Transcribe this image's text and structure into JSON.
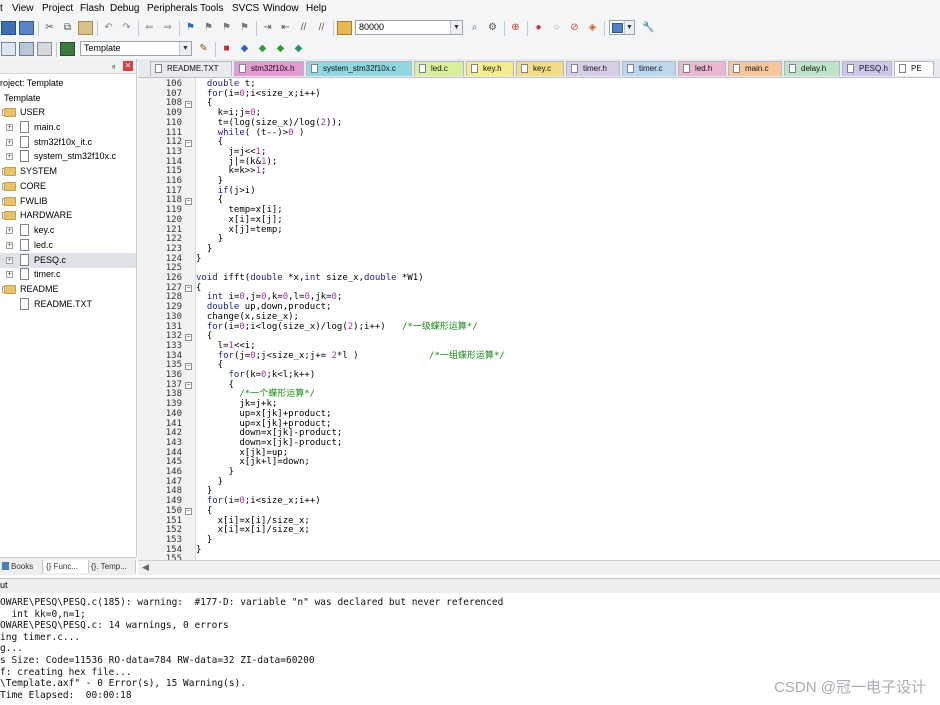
{
  "menu": [
    "t",
    "View",
    "Project",
    "Flash",
    "Debug",
    "Peripherals",
    "Tools",
    "SVCS",
    "Window",
    "Help"
  ],
  "toolbar1": {
    "target_value": "80000"
  },
  "toolbar2": {
    "target_name": "Template"
  },
  "project": {
    "title": "roject: Template",
    "root": "Template",
    "tree": [
      {
        "label": "USER",
        "kind": "folder",
        "level": 1,
        "expander": "−"
      },
      {
        "label": "main.c",
        "kind": "file",
        "level": 2,
        "expander": "+"
      },
      {
        "label": "stm32f10x_it.c",
        "kind": "file",
        "level": 2,
        "expander": "+"
      },
      {
        "label": "system_stm32f10x.c",
        "kind": "file",
        "level": 2,
        "expander": "+"
      },
      {
        "label": "SYSTEM",
        "kind": "folder",
        "level": 1,
        "expander": "+"
      },
      {
        "label": "CORE",
        "kind": "folder",
        "level": 1,
        "expander": "+"
      },
      {
        "label": "FWLIB",
        "kind": "folder",
        "level": 1,
        "expander": "+"
      },
      {
        "label": "HARDWARE",
        "kind": "folder",
        "level": 1,
        "expander": "−"
      },
      {
        "label": "key.c",
        "kind": "file",
        "level": 2,
        "expander": "+"
      },
      {
        "label": "led.c",
        "kind": "file",
        "level": 2,
        "expander": "+"
      },
      {
        "label": "PESQ.c",
        "kind": "file",
        "level": 2,
        "expander": "+",
        "selected": true
      },
      {
        "label": "timer.c",
        "kind": "file",
        "level": 2,
        "expander": "+"
      },
      {
        "label": "README",
        "kind": "folder",
        "level": 1,
        "expander": "−"
      },
      {
        "label": "README.TXT",
        "kind": "file",
        "level": 2,
        "expander": ""
      }
    ],
    "bottom_tabs": [
      "Books",
      "{} Func...",
      "{}. Temp..."
    ]
  },
  "editor": {
    "tabs": [
      {
        "label": "README.TXT",
        "color": "#e8eaed"
      },
      {
        "label": "stm32f10x.h",
        "color": "#e59ad0"
      },
      {
        "label": "system_stm32f10x.c",
        "color": "#8fd8e0"
      },
      {
        "label": "led.c",
        "color": "#d8ef9c"
      },
      {
        "label": "key.h",
        "color": "#f3ed8a"
      },
      {
        "label": "key.c",
        "color": "#f2dc86"
      },
      {
        "label": "timer.h",
        "color": "#d6cde6"
      },
      {
        "label": "timer.c",
        "color": "#bcd6ee"
      },
      {
        "label": "led.h",
        "color": "#e9b7cf"
      },
      {
        "label": "main.c",
        "color": "#f6c79b"
      },
      {
        "label": "delay.h",
        "color": "#bfe3c8"
      },
      {
        "label": "PESQ.h",
        "color": "#ccc6ea"
      },
      {
        "label": "PE",
        "color": "#ffffff"
      }
    ],
    "active_tab": "PESQ.c",
    "lines": [
      {
        "n": "106",
        "f": "",
        "t": "  double t;"
      },
      {
        "n": "107",
        "f": "",
        "t": "  for(i=0;i<size_x;i++)"
      },
      {
        "n": "108",
        "f": "−",
        "t": "  {"
      },
      {
        "n": "109",
        "f": "",
        "t": "    k=i;j=0;"
      },
      {
        "n": "110",
        "f": "",
        "t": "    t=(log(size_x)/log(2));"
      },
      {
        "n": "111",
        "f": "",
        "t": "    while( (t--)>0 )"
      },
      {
        "n": "112",
        "f": "−",
        "t": "    {"
      },
      {
        "n": "113",
        "f": "",
        "t": "      j=j<<1;"
      },
      {
        "n": "114",
        "f": "",
        "t": "      j|=(k&1);"
      },
      {
        "n": "115",
        "f": "",
        "t": "      k=k>>1;"
      },
      {
        "n": "116",
        "f": "",
        "t": "    }"
      },
      {
        "n": "117",
        "f": "",
        "t": "    if(j>i)"
      },
      {
        "n": "118",
        "f": "−",
        "t": "    {"
      },
      {
        "n": "119",
        "f": "",
        "t": "      temp=x[i];"
      },
      {
        "n": "120",
        "f": "",
        "t": "      x[i]=x[j];"
      },
      {
        "n": "121",
        "f": "",
        "t": "      x[j]=temp;"
      },
      {
        "n": "122",
        "f": "",
        "t": "    }"
      },
      {
        "n": "123",
        "f": "",
        "t": "  }"
      },
      {
        "n": "124",
        "f": "",
        "t": "}"
      },
      {
        "n": "125",
        "f": "",
        "t": ""
      },
      {
        "n": "126",
        "f": "",
        "t": "void ifft(double *x,int size_x,double *W1)"
      },
      {
        "n": "127",
        "f": "−",
        "t": "{"
      },
      {
        "n": "128",
        "f": "",
        "t": "  int i=0,j=0,k=0,l=0,jk=0;"
      },
      {
        "n": "129",
        "f": "",
        "t": "  double up,down,product;"
      },
      {
        "n": "130",
        "f": "",
        "t": "  change(x,size_x);"
      },
      {
        "n": "131",
        "f": "",
        "t": "  for(i=0;i<log(size_x)/log(2);i++)   /*一级蝶形运算*/"
      },
      {
        "n": "132",
        "f": "−",
        "t": "  {"
      },
      {
        "n": "133",
        "f": "",
        "t": "    l=1<<i;"
      },
      {
        "n": "134",
        "f": "",
        "t": "    for(j=0;j<size_x;j+= 2*l )             /*一组蝶形运算*/"
      },
      {
        "n": "135",
        "f": "−",
        "t": "    {"
      },
      {
        "n": "136",
        "f": "",
        "t": "      for(k=0;k<l;k++)"
      },
      {
        "n": "137",
        "f": "−",
        "t": "      {"
      },
      {
        "n": "138",
        "f": "",
        "t": "        /*一个蝶形运算*/"
      },
      {
        "n": "139",
        "f": "",
        "t": "        jk=j+k;"
      },
      {
        "n": "140",
        "f": "",
        "t": "        up=x[jk]+product;"
      },
      {
        "n": "141",
        "f": "",
        "t": "        up=x[jk]+product;"
      },
      {
        "n": "142",
        "f": "",
        "t": "        down=x[jk]-product;"
      },
      {
        "n": "143",
        "f": "",
        "t": "        down=x[jk]-product;"
      },
      {
        "n": "144",
        "f": "",
        "t": "        x[jk]=up;"
      },
      {
        "n": "145",
        "f": "",
        "t": "        x[jk+l]=down;"
      },
      {
        "n": "146",
        "f": "",
        "t": "      }"
      },
      {
        "n": "147",
        "f": "",
        "t": "    }"
      },
      {
        "n": "148",
        "f": "",
        "t": "  }"
      },
      {
        "n": "149",
        "f": "",
        "t": "  for(i=0;i<size_x;i++)"
      },
      {
        "n": "150",
        "f": "−",
        "t": "  {"
      },
      {
        "n": "151",
        "f": "",
        "t": "    x[i]=x[i]/size_x;"
      },
      {
        "n": "152",
        "f": "",
        "t": "    x[i]=x[i]/size_x;"
      },
      {
        "n": "153",
        "f": "",
        "t": "  }"
      },
      {
        "n": "154",
        "f": "",
        "t": "}"
      },
      {
        "n": "155",
        "f": "",
        "t": ""
      }
    ]
  },
  "output": {
    "title": "ut",
    "lines": [
      "OWARE\\PESQ\\PESQ.c(185): warning:  #177-D: variable \"n\" was declared but never referenced",
      "  int kk=0,n=1;",
      "OWARE\\PESQ\\PESQ.c: 14 warnings, 0 errors",
      "ing timer.c...",
      "g...",
      "s Size: Code=11536 RO-data=784 RW-data=32 ZI-data=60200",
      "f: creating hex file...",
      "\\Template.axf\" - 0 Error(s), 15 Warning(s).",
      "Time Elapsed:  00:00:18"
    ]
  },
  "watermark": "CSDN @冠一电子设计"
}
